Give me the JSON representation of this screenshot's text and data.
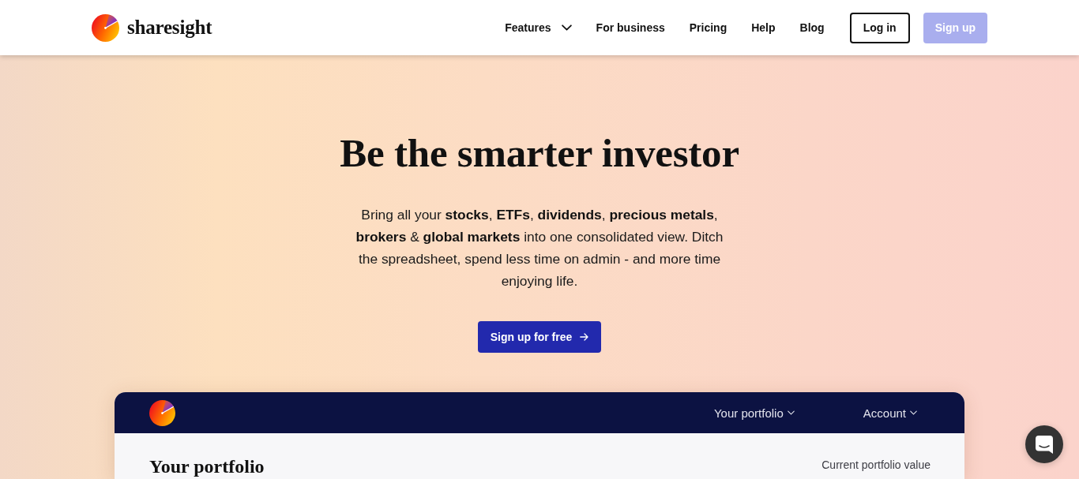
{
  "header": {
    "brand": "sharesight",
    "nav": [
      {
        "label": "Features",
        "kind": "dropdown"
      },
      {
        "label": "For business",
        "kind": "link"
      },
      {
        "label": "Pricing",
        "kind": "link"
      },
      {
        "label": "Help",
        "kind": "link"
      },
      {
        "label": "Blog",
        "kind": "link"
      }
    ],
    "login_button": "Log in",
    "signup_button": "Sign up"
  },
  "hero": {
    "title": "Be the smarter investor",
    "description": "Bring all your **stocks**, **ETFs**, **dividends**, **precious metals**, **brokers** & **global markets** into one consolidated view. Ditch the spreadsheet, spend less time on admin - and more time enjoying life.",
    "cta_button": "Sign up for free"
  },
  "app_preview": {
    "nav": [
      "Your portfolio",
      "Account"
    ],
    "title": "Your portfolio",
    "value_label": "Current portfolio value"
  }
}
